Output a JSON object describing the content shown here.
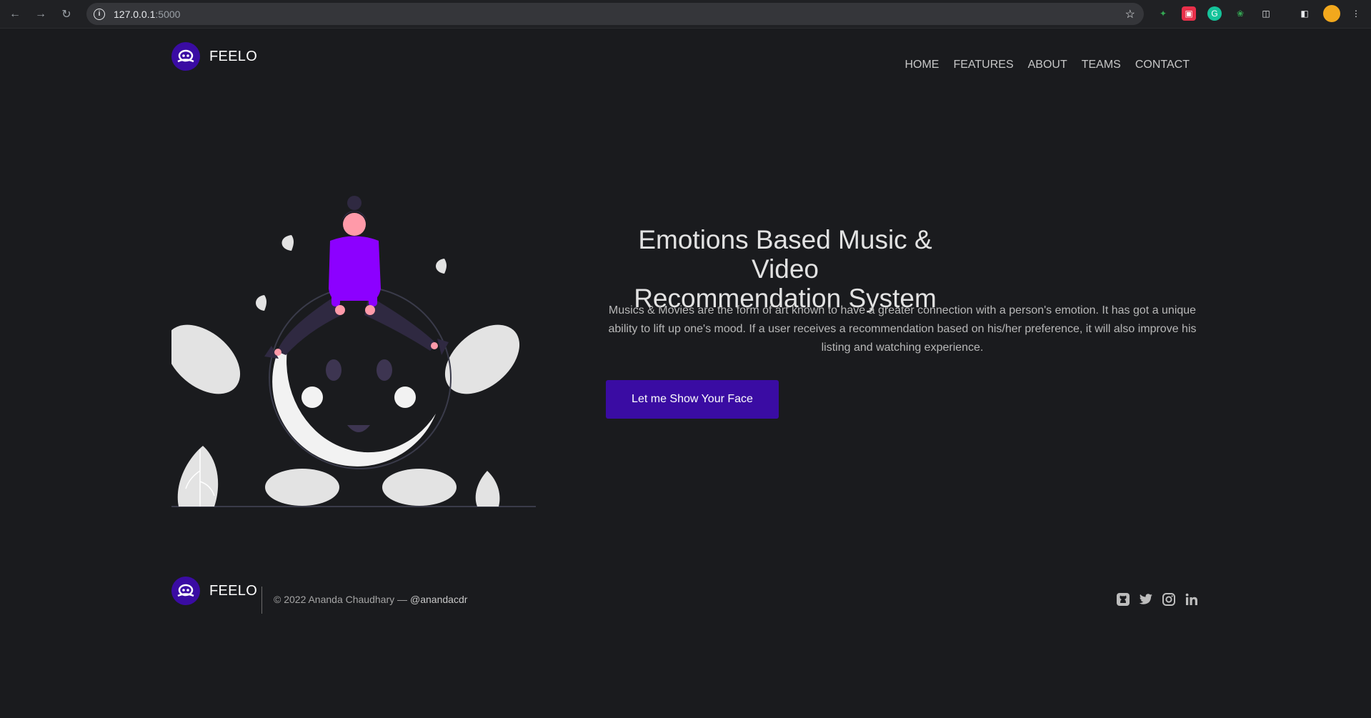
{
  "browser": {
    "url_host": "127.0.0.1",
    "url_port": ":5000"
  },
  "header": {
    "brand": "FEELO",
    "nav": [
      "HOME",
      "FEATURES",
      "ABOUT",
      "TEAMS",
      "CONTACT"
    ]
  },
  "hero": {
    "title_line1": "Emotions Based Music & Video",
    "title_line2": "Recommendation System",
    "text_line1": "Musics & Movies are the form of art known to have a greater connection with a person's emotion. It has got a unique",
    "text_line2": "ability to lift up one's mood. If a user receives a recommendation based on his/her preference, it will also improve his",
    "text_line3": "listing and watching experience.",
    "cta": "Let me Show Your Face"
  },
  "footer": {
    "brand": "FEELO",
    "copyright": "© 2022 Ananda Chaudhary —",
    "handle": "@anandacdr",
    "social": [
      "github-icon",
      "twitter-icon",
      "instagram-icon",
      "linkedin-icon"
    ]
  },
  "colors": {
    "accent": "#3a0ca3",
    "figure": "#8c00ff",
    "background": "#1a1b1e"
  }
}
